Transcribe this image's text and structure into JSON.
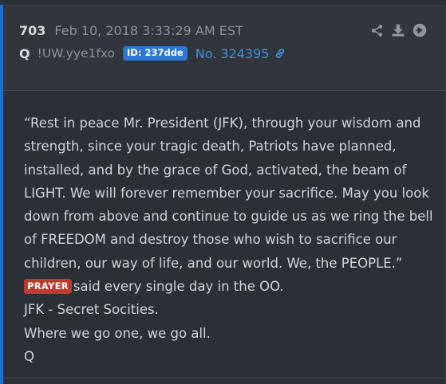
{
  "post": {
    "number": "703",
    "date": "Feb 10, 2018 3:33:29 AM EST",
    "author": "Q",
    "tripcode": "!UW.yye1fxo",
    "id_badge": "ID: 237dde",
    "post_ref": "No. 324395",
    "actions": {
      "share_icon": "share-icon",
      "download_icon": "download-icon",
      "goto_icon": "arrow-right-circle-icon"
    },
    "body": {
      "quote_lines": [
        "“Rest in peace Mr. President (JFK), through your wisdom and",
        "strength, since your tragic death, Patriots have planned,",
        "installed, and by the grace of God, activated, the beam of",
        "LIGHT. We will forever remember your sacrifice. May you look",
        "down from above and continue to guide us as we ring the bell",
        "of FREEDOM and destroy those who wish to sacrifice our",
        "children, our way of life, and our world. We, the PEOPLE.”"
      ],
      "tag": "PRAYER",
      "tag_suffix": "said every single day in the OO.",
      "line_jfk": "JFK - Secret Socities.",
      "line_wwg1wga": "Where we go one, we go all.",
      "signature": "Q"
    }
  },
  "colors": {
    "background": "#2b3036",
    "header_background": "#31363c",
    "accent_bar": "#1f6fd1",
    "id_badge": "#2b77d6",
    "link": "#3d8ee6",
    "tag": "#c0392b",
    "text": "#cfd4d9",
    "muted_text": "#8a9198"
  }
}
